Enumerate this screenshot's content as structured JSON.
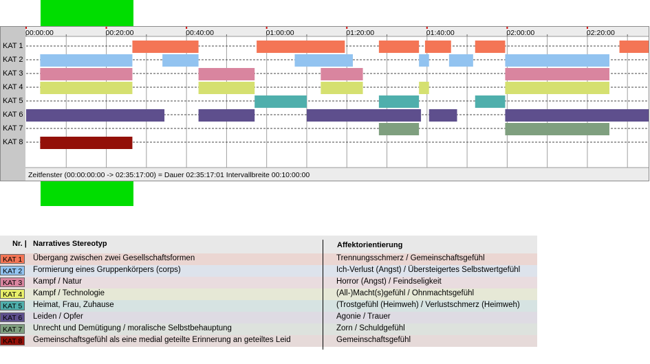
{
  "chart_data": {
    "type": "gantt",
    "x_unit": "hh:mm:ss",
    "xlim": [
      "00:00:00",
      "02:35:17"
    ],
    "tick_labels": [
      "00:00:00",
      "00:20:00",
      "00:40:00",
      "01:00:00",
      "01:20:00",
      "01:40:00",
      "02:00:00",
      "02:20:00"
    ],
    "category_labels": [
      "KAT 1",
      "KAT 2",
      "KAT 3",
      "KAT 4",
      "KAT 5",
      "KAT 6",
      "KAT 7",
      "KAT 8"
    ],
    "series": [
      {
        "id": "KAT 1",
        "color": "#f47555",
        "intervals": [
          [
            "00:26:30",
            "00:43:00"
          ],
          [
            "00:57:30",
            "01:19:30"
          ],
          [
            "01:28:00",
            "01:38:00"
          ],
          [
            "01:39:30",
            "01:46:00"
          ],
          [
            "01:52:00",
            "01:59:30"
          ],
          [
            "02:28:00",
            "02:35:17"
          ]
        ]
      },
      {
        "id": "KAT 2",
        "color": "#92c3f0",
        "intervals": [
          [
            "00:03:30",
            "00:26:30"
          ],
          [
            "00:34:00",
            "00:43:00"
          ],
          [
            "01:07:00",
            "01:21:30"
          ],
          [
            "01:38:00",
            "01:40:30"
          ],
          [
            "01:45:30",
            "01:51:30"
          ],
          [
            "01:59:30",
            "02:25:30"
          ]
        ]
      },
      {
        "id": "KAT 3",
        "color": "#d9859f",
        "intervals": [
          [
            "00:03:30",
            "00:26:30"
          ],
          [
            "00:43:00",
            "00:57:00"
          ],
          [
            "01:13:30",
            "01:24:00"
          ],
          [
            "01:59:30",
            "02:25:30"
          ]
        ]
      },
      {
        "id": "KAT 4",
        "color": "#d5e070",
        "intervals": [
          [
            "00:03:30",
            "00:26:30"
          ],
          [
            "00:43:00",
            "00:57:00"
          ],
          [
            "01:13:30",
            "01:24:00"
          ],
          [
            "01:38:00",
            "01:40:30"
          ],
          [
            "01:59:30",
            "02:25:30"
          ]
        ]
      },
      {
        "id": "KAT 5",
        "color": "#4fafac",
        "intervals": [
          [
            "00:57:00",
            "01:10:00"
          ],
          [
            "01:28:00",
            "01:38:00"
          ],
          [
            "01:52:00",
            "01:59:30"
          ]
        ]
      },
      {
        "id": "KAT 6",
        "color": "#5e4f8d",
        "intervals": [
          [
            "00:00:00",
            "00:34:30"
          ],
          [
            "00:43:00",
            "00:57:00"
          ],
          [
            "01:10:00",
            "01:38:30"
          ],
          [
            "01:40:30",
            "01:47:30"
          ],
          [
            "01:59:30",
            "02:35:17"
          ]
        ]
      },
      {
        "id": "KAT 7",
        "color": "#7f9f7f",
        "intervals": [
          [
            "01:28:00",
            "01:38:00"
          ],
          [
            "01:59:30",
            "02:25:30"
          ]
        ]
      },
      {
        "id": "KAT 8",
        "color": "#931008",
        "intervals": [
          [
            "00:03:30",
            "00:26:30"
          ]
        ]
      }
    ],
    "status_text": "Zeitfenster (00:00:00:00 -> 02:35:17:00) = Dauer 02:35:17:01     Intervallbreite 00:10:00:00"
  },
  "legend": {
    "header": {
      "nr": "Nr. |",
      "narrative": "Narratives Stereotyp",
      "affekt": "Affektorientierung"
    },
    "rows": [
      {
        "badge": "KAT 1",
        "badge_color": "#f47555",
        "row_bg": "#ebd6d2",
        "narrative": "Übergang zwischen zwei Gesellschaftsformen",
        "affekt": "Trennungsschmerz / Gemeinschaftsgefühl"
      },
      {
        "badge": "KAT 2",
        "badge_color": "#92c3f0",
        "row_bg": "#dde3ec",
        "narrative": "Formierung eines Gruppenkörpers (corps)",
        "affekt": "Ich-Verlust (Angst) / Übersteigertes Selbstwertgefühl"
      },
      {
        "badge": "KAT 3",
        "badge_color": "#d9859f",
        "row_bg": "#e9dcdf",
        "narrative": "Kampf / Natur",
        "affekt": "Horror (Angst) / Feindseligkeit"
      },
      {
        "badge": "KAT 4",
        "badge_color": "#e8ef6a",
        "row_bg": "#e6e8d6",
        "narrative": "Kampf / Technologie",
        "affekt": "(All-)Macht(s)gefühl / Ohnmachtsgefühl"
      },
      {
        "badge": "KAT 5",
        "badge_color": "#4fafac",
        "row_bg": "#d6e3e2",
        "narrative": "Heimat, Frau, Zuhause",
        "affekt": "(Trostgefühl (Heimweh) / Verlustschmerz (Heimweh)"
      },
      {
        "badge": "KAT 6",
        "badge_color": "#5e4f8d",
        "row_bg": "#dedbe3",
        "narrative": "Leiden / Opfer",
        "affekt": "Agonie / Trauer"
      },
      {
        "badge": "KAT 7",
        "badge_color": "#7f9f7f",
        "row_bg": "#dde2dd",
        "narrative": "Unrecht und Demütigung / moralische Selbstbehauptung",
        "affekt": "Zorn / Schuldgefühl"
      },
      {
        "badge": "KAT 8",
        "badge_color": "#931008",
        "row_bg": "#e6dad9",
        "narrative": "Gemeinschaftsgefühl als eine medial geteilte Erinnerung an geteiltes Leid",
        "affekt": "Gemeinschaftsgefühl"
      }
    ]
  }
}
